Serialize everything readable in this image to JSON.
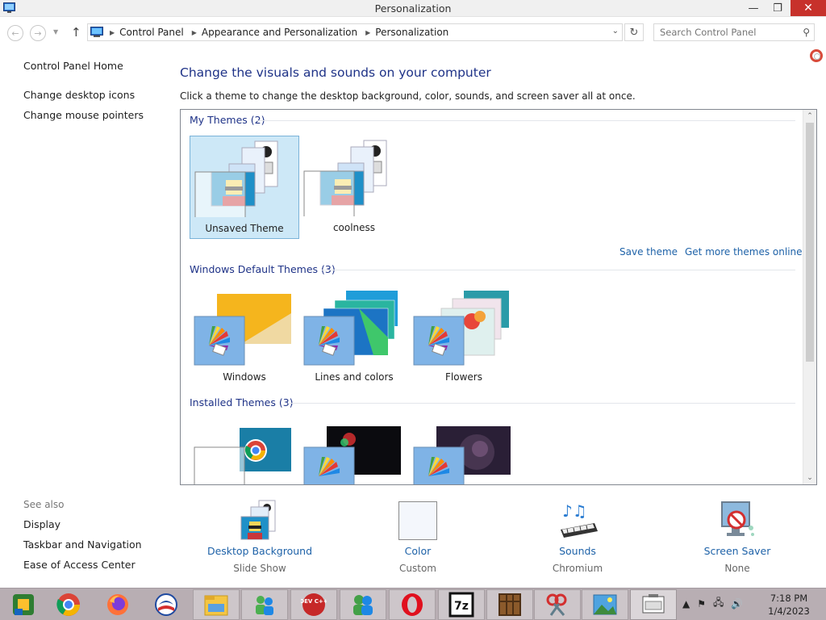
{
  "window": {
    "title": "Personalization",
    "controls": {
      "minimize": "—",
      "maximize": "❐",
      "close": "✕"
    }
  },
  "addressbar": {
    "breadcrumbs": [
      "Control Panel",
      "Appearance and Personalization",
      "Personalization"
    ],
    "search_placeholder": "Search Control Panel"
  },
  "leftnav": {
    "home": "Control Panel Home",
    "links": [
      "Change desktop icons",
      "Change mouse pointers"
    ],
    "see_also_label": "See also",
    "see_also": [
      "Display",
      "Taskbar and Navigation",
      "Ease of Access Center"
    ]
  },
  "main": {
    "title": "Change the visuals and sounds on your computer",
    "description": "Click a theme to change the desktop background, color, sounds, and screen saver all at once.",
    "groups": {
      "my": {
        "header": "My Themes (2)",
        "themes": [
          "Unsaved Theme",
          "coolness"
        ]
      },
      "default": {
        "header": "Windows Default Themes (3)",
        "themes": [
          "Windows",
          "Lines and colors",
          "Flowers"
        ]
      },
      "installed": {
        "header": "Installed Themes (3)"
      }
    },
    "save_theme": "Save theme",
    "get_more": "Get more themes online"
  },
  "settings": [
    {
      "label": "Desktop Background",
      "value": "Slide Show"
    },
    {
      "label": "Color",
      "value": "Custom"
    },
    {
      "label": "Sounds",
      "value": "Chromium"
    },
    {
      "label": "Screen Saver",
      "value": "None"
    }
  ],
  "taskbar": {
    "clock_time": "7:18 PM",
    "clock_date": "1/4/2023",
    "devcpp_label": "DEV C++",
    "sevenzip_label": "7z"
  },
  "colors": {
    "accent_blue": "#1e3287",
    "link_blue": "#1e62a8",
    "selected_bg": "#cde8f7",
    "close_red": "#c7312b",
    "taskbar": "#b8aeb3"
  }
}
